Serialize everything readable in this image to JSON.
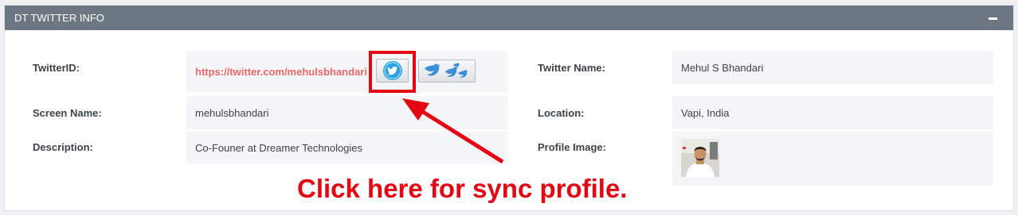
{
  "panel": {
    "title": "DT TWITTER INFO"
  },
  "fields": {
    "twitter_id": {
      "label": "TwitterID:",
      "value": "https://twitter.com/mehulsbhandari"
    },
    "screen_name": {
      "label": "Screen Name:",
      "value": "mehulsbhandari"
    },
    "description": {
      "label": "Description:",
      "value": "Co-Founer at Dreamer Technologies"
    },
    "twitter_name": {
      "label": "Twitter Name:",
      "value": "Mehul S Bhandari"
    },
    "location": {
      "label": "Location:",
      "value": "Vapi, India"
    },
    "profile_image": {
      "label": "Profile Image:"
    }
  },
  "buttons": {
    "sync_icon": "twitter-bird-icon",
    "birds_icon": "twitter-birds-icon"
  },
  "annotation": {
    "text": "Click here for sync profile."
  },
  "colors": {
    "header": "#6d7782",
    "link": "#e8696a",
    "annotation": "#e30613",
    "twitter_blue": "#2aa3e6"
  }
}
